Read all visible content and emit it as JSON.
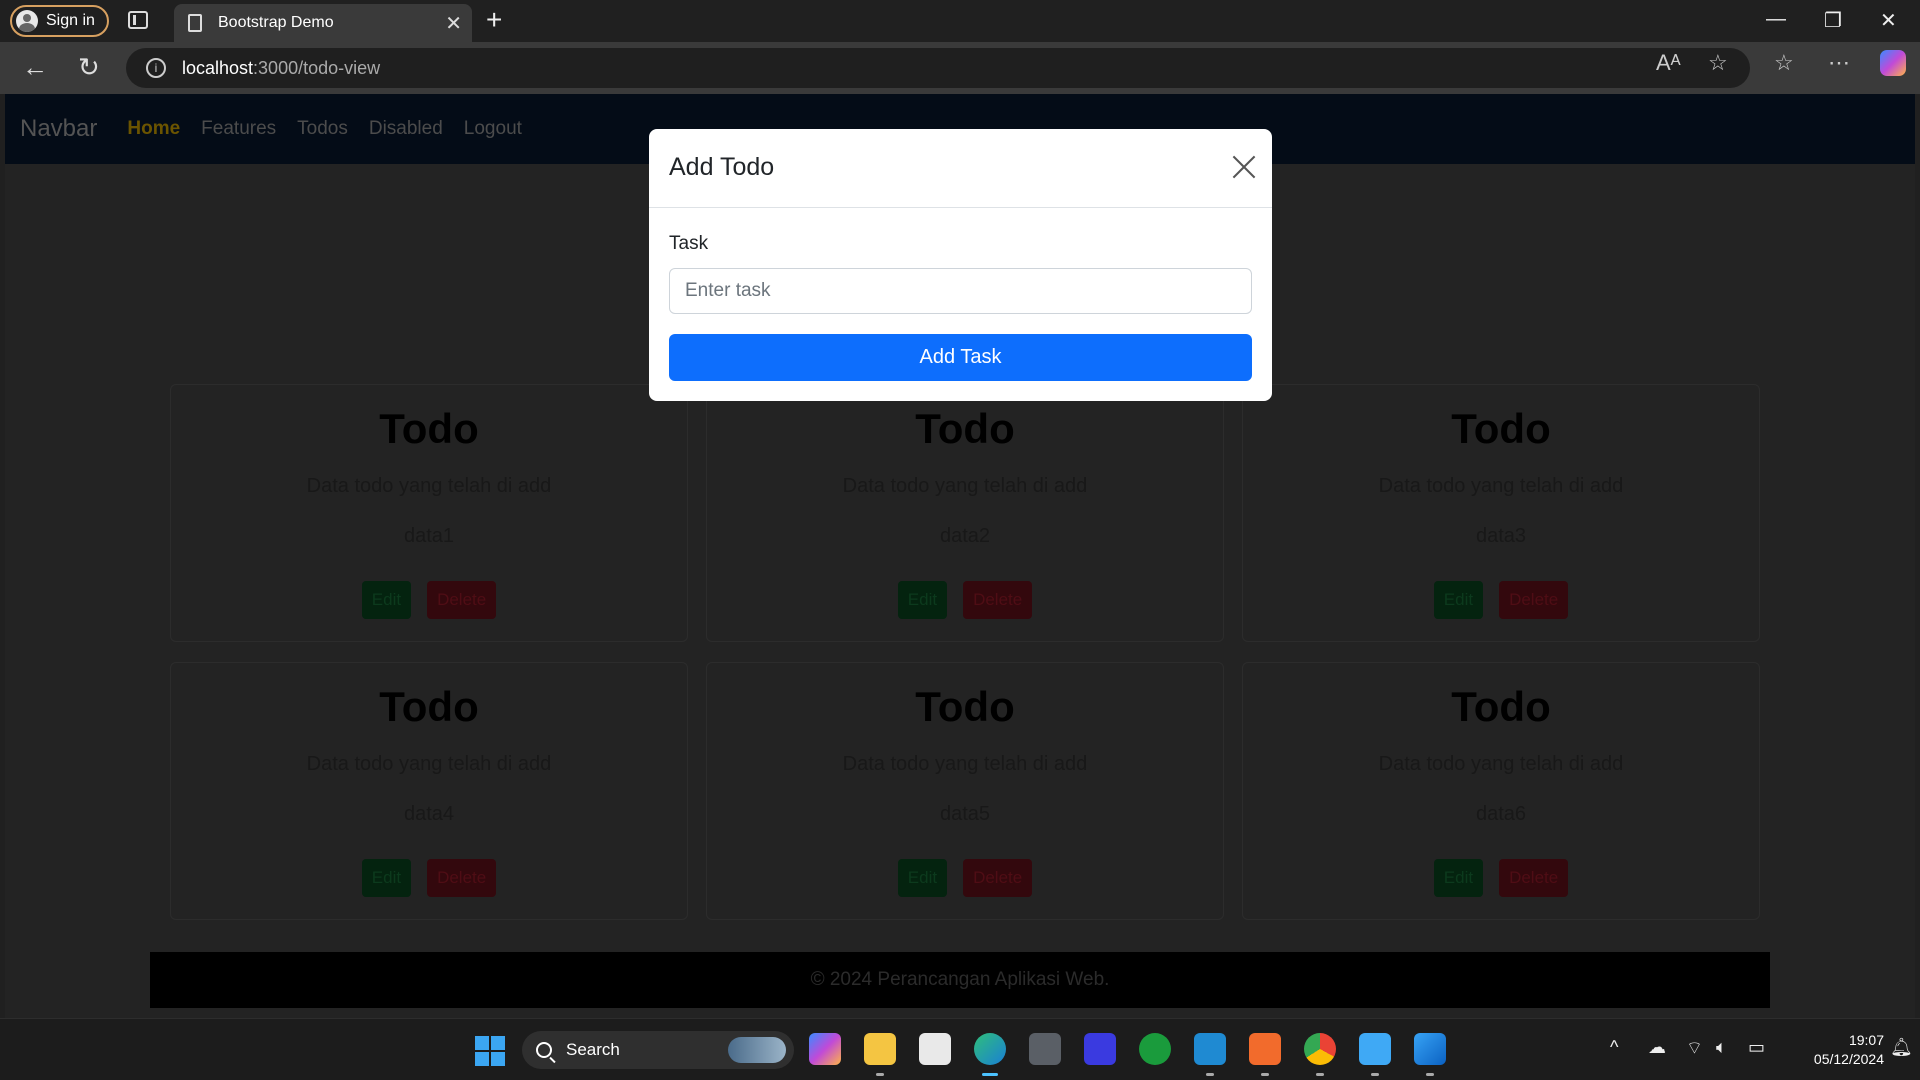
{
  "browser": {
    "signin_label": "Sign in",
    "tab_title": "Bootstrap Demo",
    "url_host": "localhost",
    "url_path": ":3000/todo-view"
  },
  "navbar": {
    "brand": "Navbar",
    "links": [
      "Home",
      "Features",
      "Todos",
      "Disabled",
      "Logout"
    ]
  },
  "cards": [
    {
      "title": "Todo",
      "desc": "Data todo yang telah di add",
      "data": "data1",
      "edit": "Edit",
      "delete": "Delete"
    },
    {
      "title": "Todo",
      "desc": "Data todo yang telah di add",
      "data": "data2",
      "edit": "Edit",
      "delete": "Delete"
    },
    {
      "title": "Todo",
      "desc": "Data todo yang telah di add",
      "data": "data3",
      "edit": "Edit",
      "delete": "Delete"
    },
    {
      "title": "Todo",
      "desc": "Data todo yang telah di add",
      "data": "data4",
      "edit": "Edit",
      "delete": "Delete"
    },
    {
      "title": "Todo",
      "desc": "Data todo yang telah di add",
      "data": "data5",
      "edit": "Edit",
      "delete": "Delete"
    },
    {
      "title": "Todo",
      "desc": "Data todo yang telah di add",
      "data": "data6",
      "edit": "Edit",
      "delete": "Delete"
    }
  ],
  "footer": "© 2024 Perancangan Aplikasi Web.",
  "modal": {
    "title": "Add Todo",
    "task_label": "Task",
    "task_placeholder": "Enter task",
    "task_value": "",
    "submit_label": "Add Task"
  },
  "taskbar": {
    "search_label": "Search",
    "time": "19:07",
    "date": "05/12/2024",
    "apps": [
      "copilot-icon",
      "file-explorer-icon",
      "store-icon",
      "edge-icon",
      "unity-icon",
      "app-icon",
      "xbox-icon",
      "vscode-icon",
      "xampp-icon",
      "chrome-icon",
      "notepad-icon",
      "photos-icon"
    ]
  },
  "colors": {
    "primary": "#0d6efd",
    "navbar_active": "#ffc107",
    "edit_button": "#198754",
    "delete_button": "#dc3545"
  }
}
